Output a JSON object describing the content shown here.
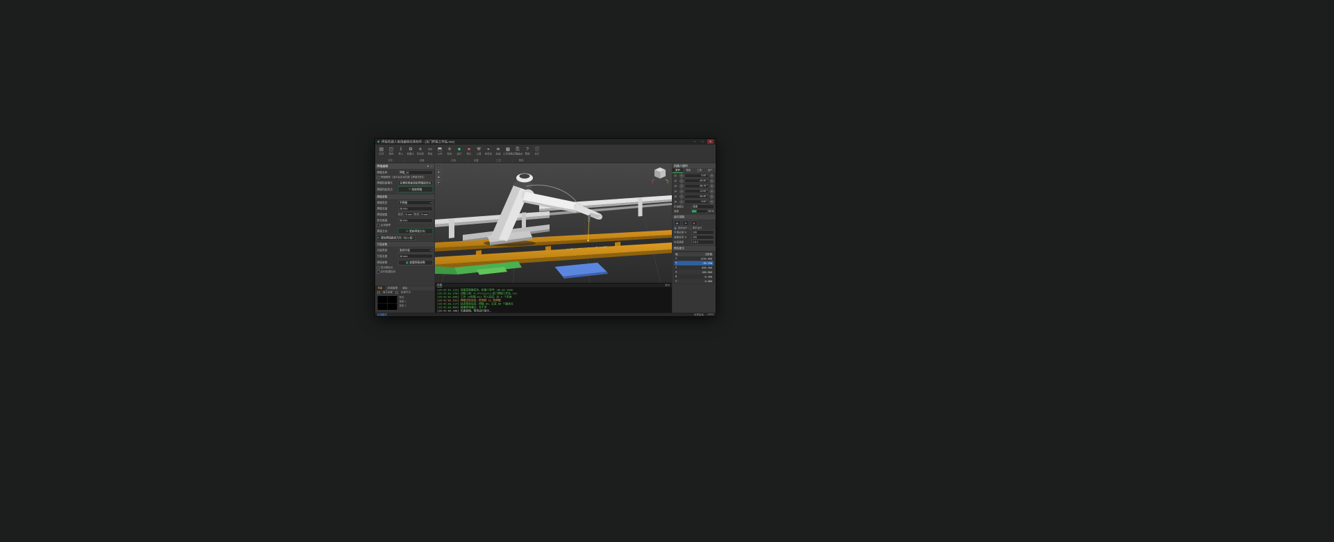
{
  "titlebar": {
    "icon": "◆",
    "title": "焊接机器人离线编程仿真软件 - [龙门焊接工作站.rws]",
    "min": "─",
    "max": "□",
    "close": "✕"
  },
  "toolbar": {
    "items": [
      {
        "icon": "▤",
        "label": "打开"
      },
      {
        "icon": "◫",
        "label": "保存"
      },
      {
        "icon": "⇩",
        "label": "导入"
      },
      {
        "icon": "⚙",
        "label": "机器人"
      },
      {
        "icon": "⌗",
        "label": "变位机"
      },
      {
        "icon": "▭",
        "label": "导轨"
      },
      {
        "icon": "⬒",
        "label": "工件"
      },
      {
        "icon": "✛",
        "label": "标定"
      },
      {
        "icon": "●",
        "label": "运行"
      },
      {
        "icon": "■",
        "label": "停止"
      },
      {
        "icon": "⚒",
        "label": "工具"
      },
      {
        "icon": "⌖",
        "label": "坐标系"
      },
      {
        "icon": "≋",
        "label": "轨迹"
      },
      {
        "icon": "▦",
        "label": "工艺参数"
      },
      {
        "icon": "⎘",
        "label": "后置输出"
      },
      {
        "icon": "?",
        "label": "帮助"
      },
      {
        "icon": "ⓘ",
        "label": "关于"
      }
    ],
    "groups": [
      "文件",
      "设备",
      "仿真",
      "设置",
      "工艺",
      "帮助"
    ]
  },
  "viewport": {
    "tools": [
      {
        "icon": "⌂",
        "name": "home"
      },
      {
        "icon": "⊕",
        "name": "zoom"
      },
      {
        "icon": "✥",
        "name": "pan"
      },
      {
        "icon": "⟳",
        "name": "rotate"
      }
    ],
    "axis_x": "X",
    "axis_y": "Y"
  },
  "left_panel": {
    "title": "焊缝编辑",
    "apply": "✓",
    "close": "✕",
    "name_label": "焊缝名称",
    "name_value": "焊缝_01",
    "track_check": "焊缝跟踪（选中后自动匹配【焊缝识别】）",
    "pick_mode_label": "焊缝拾取模式",
    "pick_mode_btn": "在模型表面拾取焊缝起终点",
    "pick_label": "焊缝的起终点",
    "pick_icon": "⌖",
    "pick_btn": "拾取焊缝",
    "sec_params": "焊缝参数",
    "type_label": "焊缝类型",
    "type_value": "平焊缝",
    "len_label": "焊缝长度",
    "len_value": "25 mm",
    "speed_label": "焊接速度",
    "speed_start_label": "起点",
    "speed_start": "5 mm",
    "speed_end_label": "终点",
    "speed_end": "5 mm",
    "height_label": "安全高度",
    "height_value": "50 mm",
    "weave_check": "启用摆焊",
    "dir_label": "焊接方向",
    "dir_icon": "⟳",
    "dir_btn": "更新焊接方向",
    "clear_icon": "⟲",
    "clear_btn": "清除焊接路径方向（共 0 段）",
    "sec_arc": "引弧参数",
    "arc_type_label": "引弧类型",
    "arc_type_value": "直线引弧",
    "arc_len_label": "引弧长度",
    "arc_len_value": "10 mm",
    "weld_param_label": "焊接参数",
    "weld_param_icon": "▦",
    "weld_param_btn": "查看焊接参数",
    "show_points_check": "显示路径点",
    "collision_check": "实时碰撞检测"
  },
  "sub_panel": {
    "tabs": [
      "场景",
      "布局管理",
      "输出"
    ],
    "filter1": "显示全部",
    "filter2": "轨迹可见",
    "views": [
      "视角 1",
      "视角 2"
    ],
    "preview_label": "预览"
  },
  "right_panel": {
    "title": "机器人操作",
    "tabs": [
      "关节",
      "基座",
      "工具",
      "用户"
    ],
    "jog_minus": "−",
    "jog_plus": "+",
    "axes": [
      {
        "name": "J1",
        "value": "0.00 °"
      },
      {
        "name": "J2",
        "value": "-45.30 °"
      },
      {
        "name": "J3",
        "value": "68.75 °"
      },
      {
        "name": "J4",
        "value": "12.00 °"
      },
      {
        "name": "J5",
        "value": "-36.45 °"
      },
      {
        "name": "J6",
        "value": "0.00 °"
      }
    ],
    "step_label": "步进模式",
    "step_value": "连续",
    "speed_label": "速度",
    "speed_value": "30 %",
    "sec_run": "运行控制",
    "play": "▶",
    "pause": "⏸",
    "stop": "■",
    "mode1": "连续运行",
    "mode2": "单步运行",
    "smooth_label": "平滑过渡 %",
    "smooth_value": "100",
    "rate_label": "速度倍率 %",
    "rate_value": "100",
    "sim_label": "仿真速度",
    "sim_value": "1.0 x",
    "sec_coord": "坐标显示",
    "coord_h1": "轴",
    "coord_h2": "当前值",
    "coords": [
      {
        "name": "X",
        "value": "1250.000"
      },
      {
        "name": "Y",
        "value": "-35.250"
      },
      {
        "name": "Z",
        "value": "896.500"
      },
      {
        "name": "A",
        "value": "180.000"
      },
      {
        "name": "B",
        "value": "-0.500"
      },
      {
        "name": "C",
        "value": "0.000"
      }
    ]
  },
  "log": {
    "tab": "日志",
    "clear": "清空",
    "lines": [
      {
        "text": "[16:42:01.125] 连接控制器成功，机器人型号：HR-S6-1400"
      },
      {
        "text": "[16:42:01.378] 加载工程：D:/Projects/龙门焊接工作站.rws"
      },
      {
        "text": "[16:42:02.046] 工件 [H型钢-01] 导入完成，共 3 个实体"
      },
      {
        "text": "[16:42:02.531] 焊缝识别完成：检测到 12 条焊缝"
      },
      {
        "text": "[16:42:03.117] 轨迹规划完成：焊缝_05，生成 86 个路径点"
      },
      {
        "text": "[16:42:03.664] 碰撞检测通过，无干涉"
      },
      {
        "text": "[16:42:04.208] 仿真就绪，等待运行指令…"
      }
    ]
  },
  "statusbar": {
    "mode": "仿真模式",
    "coord": "世界坐标",
    "zoom": "100%"
  },
  "glyphs": {
    "check": "✓",
    "arrow": "▾"
  }
}
